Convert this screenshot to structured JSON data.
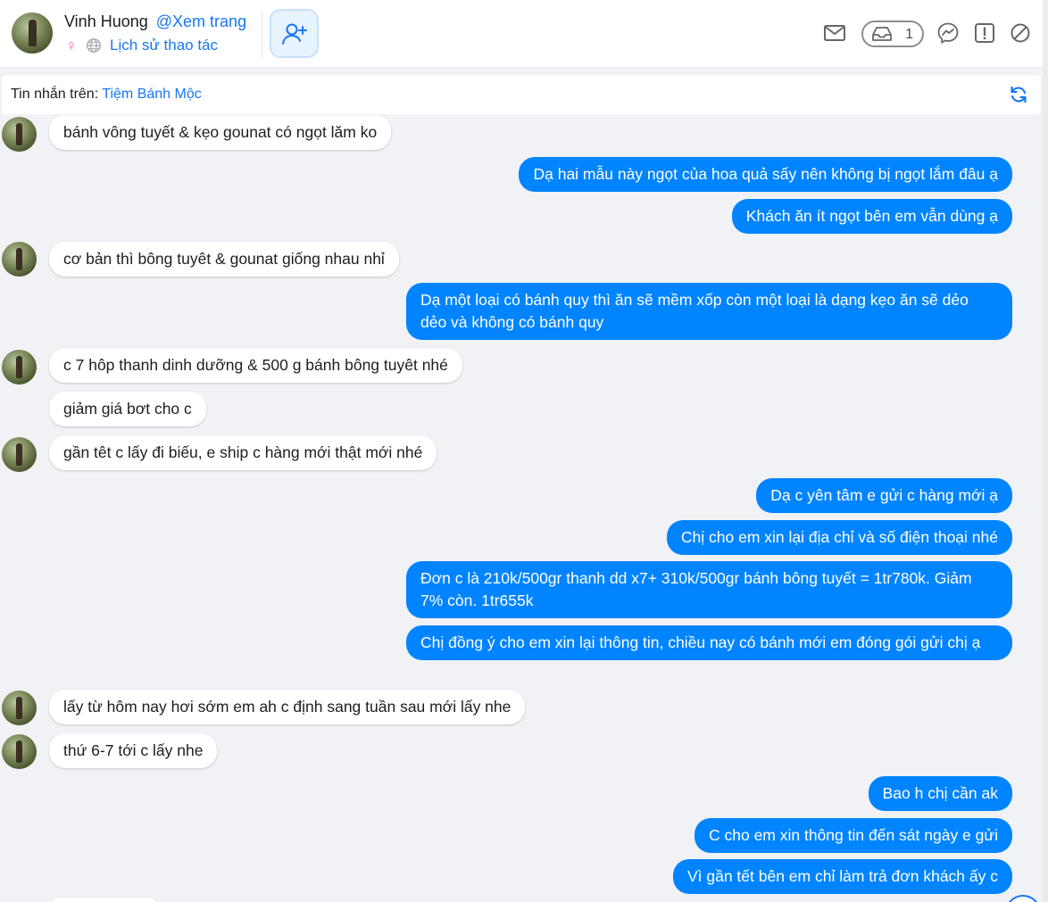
{
  "header": {
    "name": "Vinh Huong",
    "page_link": "@Xem trang",
    "history_link": "Lịch sử thao tác",
    "gender_symbol": "♀",
    "inbox_count": "1",
    "icons": [
      "female-icon",
      "globe-icon",
      "add-friend-icon",
      "mail-icon",
      "inbox-icon",
      "messenger-icon",
      "report-icon",
      "block-icon"
    ]
  },
  "message_bar": {
    "label": "Tin nhắn trên:",
    "page_name": "Tiệm Bánh Mộc"
  },
  "messages": [
    {
      "dir": "in",
      "avatar": true,
      "text": "bánh vông tuyết & kẹo gounat có ngọt lăm ko"
    },
    {
      "dir": "out",
      "text": "Dạ hai mẫu này ngọt của hoa quả sấy nên không bị ngọt lắm đâu ạ"
    },
    {
      "dir": "out",
      "text": "Khách ăn ít ngọt bên em vẫn dùng ạ"
    },
    {
      "dir": "in",
      "avatar": true,
      "text": "cơ bản thì bông tuyêt & gounat giống nhau nhỉ"
    },
    {
      "dir": "out",
      "text": "Dạ một loại có bánh quy thì ăn sẽ mềm xốp còn một loại là dạng kẹo ăn sẽ dẻo dẻo và không có bánh quy"
    },
    {
      "dir": "in",
      "avatar": true,
      "text": "c 7 hôp thanh dinh dưỡng & 500 g bánh bông tuyêt nhé"
    },
    {
      "dir": "in",
      "avatar": false,
      "text": "giảm giá bơt cho c"
    },
    {
      "dir": "in",
      "avatar": true,
      "text": "gần têt c lấy đi biếu, e ship c hàng mới thật mới nhé"
    },
    {
      "dir": "out",
      "text": "Dạ c yên tâm e gửi c hàng mới ạ"
    },
    {
      "dir": "out",
      "text": "Chị cho em xin lại địa chỉ và số điện thoại nhé"
    },
    {
      "dir": "out",
      "text": "Đơn c là 210k/500gr thanh dd x7+ 310k/500gr bánh bông tuyết = 1tr780k. Giảm 7% còn. 1tr655k"
    },
    {
      "dir": "out",
      "text": "Chị đồng ý cho em xin lại thông tin, chiều nay có bánh mới em đóng gói gửi chị ạ"
    },
    {
      "dir": "in",
      "avatar": true,
      "text": "lấy từ hôm nay hơi sớm em ah c định sang tuần sau mới lấy nhe"
    },
    {
      "dir": "in",
      "avatar": true,
      "text": "thứ 6-7 tới c lấy nhe"
    },
    {
      "dir": "out",
      "text": "Bao h chị cần ak"
    },
    {
      "dir": "out",
      "text": "C cho em xin thông tin đến sát ngày e gửi"
    },
    {
      "dir": "out",
      "text": "Vì gần tết bên em chỉ làm trả đơn khách ấy c"
    }
  ]
}
